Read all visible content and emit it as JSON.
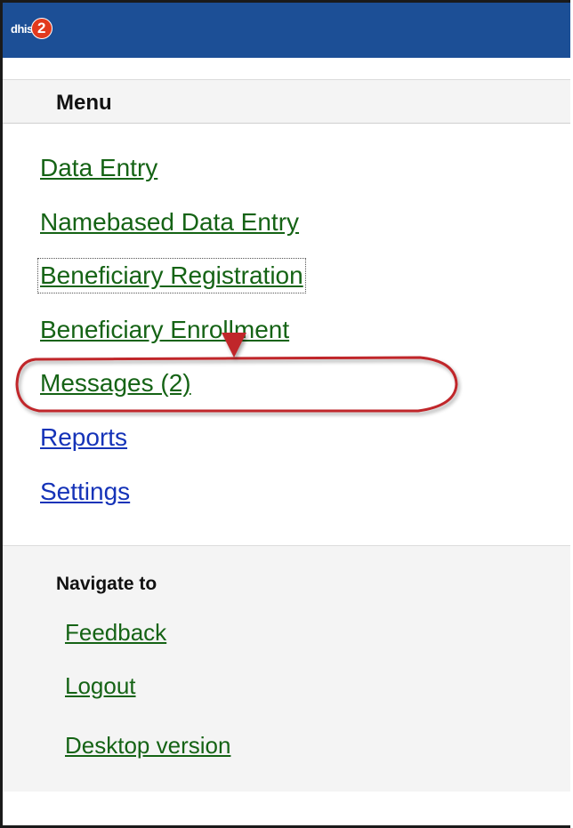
{
  "header": {
    "logo_text": "dhis",
    "logo_badge": "2",
    "background_color": "#1c4f96"
  },
  "menu": {
    "title": "Menu",
    "items": [
      {
        "label": "Data Entry",
        "color": "#156315"
      },
      {
        "label": "Namebased Data Entry",
        "color": "#156315"
      },
      {
        "label": "Beneficiary Registration",
        "color": "#156315"
      },
      {
        "label": "Beneficiary Enrollment",
        "color": "#156315"
      },
      {
        "label": "Messages (2)",
        "color": "#156315"
      },
      {
        "label": "Reports",
        "color": "#1533b8"
      },
      {
        "label": "Settings",
        "color": "#1533b8"
      }
    ]
  },
  "navigate": {
    "title": "Navigate to",
    "items": [
      {
        "label": "Feedback"
      },
      {
        "label": "Logout"
      },
      {
        "label": "Desktop version"
      }
    ]
  },
  "annotation": {
    "arrow_color": "#c0282a",
    "highlight_color": "#c0282a"
  }
}
